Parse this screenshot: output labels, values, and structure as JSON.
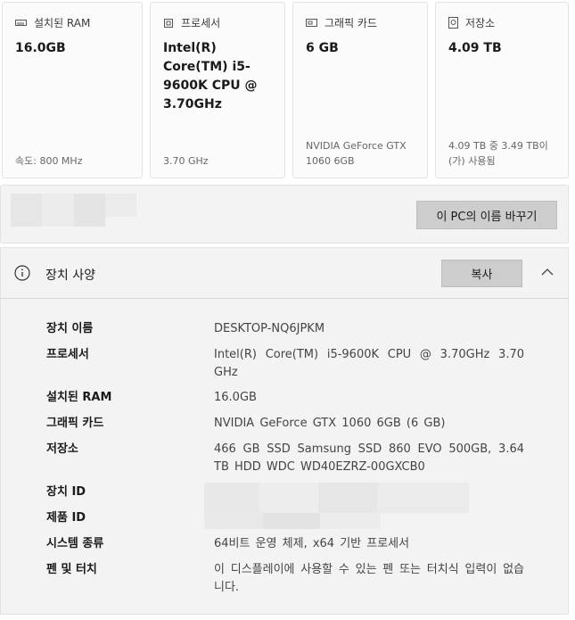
{
  "cards": [
    {
      "title": "설치된 RAM",
      "icon": "ram-icon",
      "value": "16.0GB",
      "footer": "속도: 800 MHz"
    },
    {
      "title": "프로세서",
      "icon": "processor-icon",
      "value": "Intel(R) Core(TM) i5-9600K CPU @ 3.70GHz",
      "footer": "3.70 GHz"
    },
    {
      "title": "그래픽 카드",
      "icon": "graphics-card-icon",
      "value": "6 GB",
      "footer": "NVIDIA GeForce GTX 1060 6GB"
    },
    {
      "title": "저장소",
      "icon": "storage-icon",
      "value": "4.09 TB",
      "footer": "4.09 TB 중 3.49 TB이(가) 사용됨"
    }
  ],
  "rename": {
    "button_label": "이 PC의 이름 바꾸기"
  },
  "spec": {
    "title": "장치 사양",
    "copy_label": "복사",
    "rows": [
      {
        "label": "장치 이름",
        "value": "DESKTOP-NQ6JPKM"
      },
      {
        "label": "프로세서",
        "value": "Intel(R) Core(TM) i5-9600K CPU @ 3.70GHz 3.70 GHz"
      },
      {
        "label": "설치된 RAM",
        "value": "16.0GB"
      },
      {
        "label": "그래픽 카드",
        "value": "NVIDIA GeForce GTX 1060 6GB (6 GB)"
      },
      {
        "label": "저장소",
        "value": "466 GB SSD Samsung SSD 860 EVO 500GB, 3.64 TB HDD WDC WD40EZRZ-00GXCB0"
      },
      {
        "label": "장치 ID",
        "value": ""
      },
      {
        "label": "제품 ID",
        "value": ""
      },
      {
        "label": "시스템 종류",
        "value": "64비트 운영 체제, x64 기반 프로세서"
      },
      {
        "label": "펜 및 터치",
        "value": "이 디스플레이에 사용할 수 있는 펜 또는 터치식 입력이 없습니다."
      }
    ]
  }
}
